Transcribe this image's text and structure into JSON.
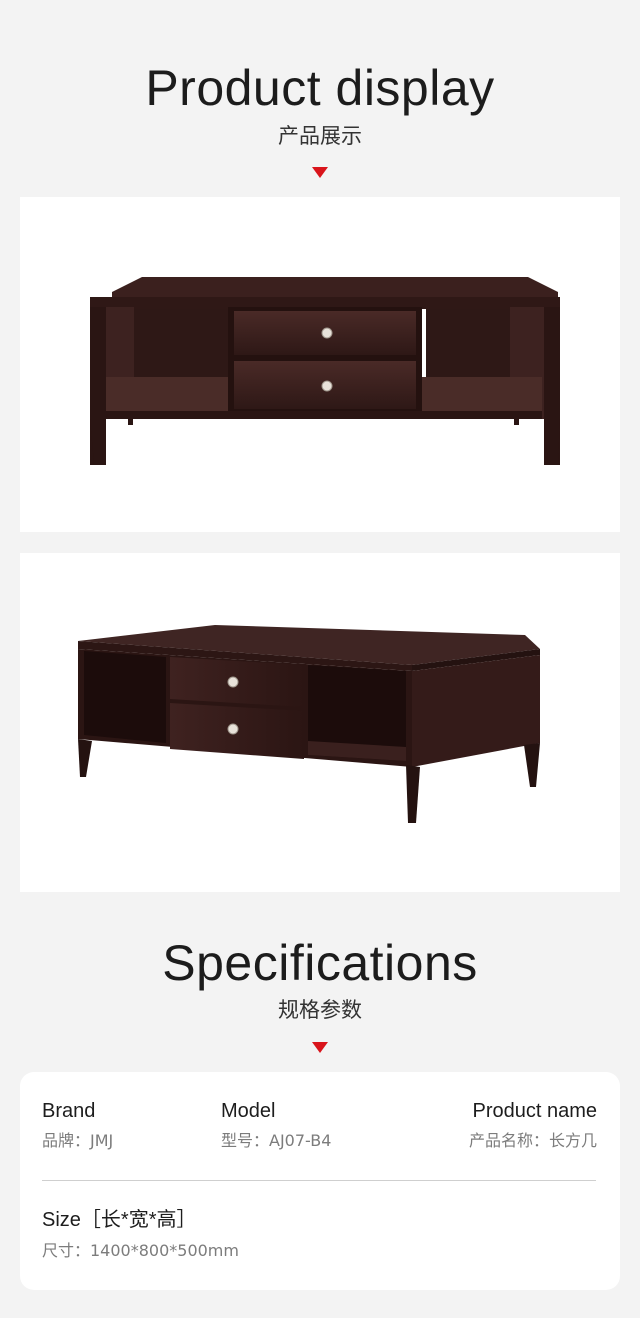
{
  "display": {
    "title_en": "Product display",
    "title_cn": "产品展示"
  },
  "photos": [
    {
      "icon": "coffee-table-front-view"
    },
    {
      "icon": "coffee-table-angled-view"
    }
  ],
  "specifications": {
    "title_en": "Specifications",
    "title_cn": "规格参数",
    "brand": {
      "label": "Brand",
      "value": "品牌：JMJ"
    },
    "model": {
      "label": "Model",
      "value": "型号：AJ07-B4"
    },
    "product_name": {
      "label": "Product name",
      "value": "产品名称：长方几"
    },
    "size": {
      "label": "Size［长*宽*高］",
      "value": "尺寸：1400*800*500mm"
    }
  },
  "colors": {
    "background": "#f3f3f3",
    "card": "#ffffff",
    "accent_red": "#d9141b",
    "wood_dark": "#3a1f1d"
  }
}
